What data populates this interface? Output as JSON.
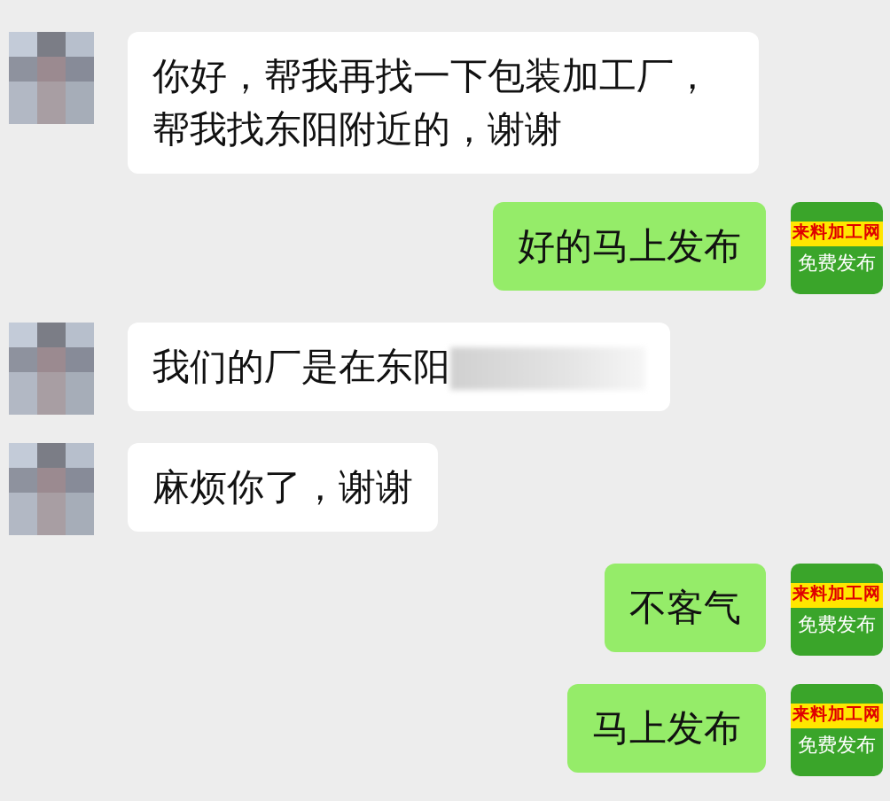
{
  "messages": [
    {
      "kind": "incoming",
      "text": "你好，帮我再找一下包装加工厂，帮我找东阳附近的，谢谢"
    },
    {
      "kind": "outgoing",
      "text": "好的马上发布",
      "avatar": {
        "kind": "logo",
        "title": "来料加工网",
        "caption": "免费发布"
      }
    },
    {
      "kind": "incoming",
      "text": "我们的厂是在东阳",
      "redacted": true
    },
    {
      "kind": "incoming",
      "text": "麻烦你了，谢谢"
    },
    {
      "kind": "outgoing",
      "text": "不客气",
      "avatar": {
        "kind": "logo",
        "title": "来料加工网",
        "caption": "免费发布"
      }
    },
    {
      "kind": "outgoing",
      "text": "马上发布",
      "avatar": {
        "kind": "logo",
        "title": "来料加工网",
        "caption": "免费发布"
      }
    }
  ]
}
